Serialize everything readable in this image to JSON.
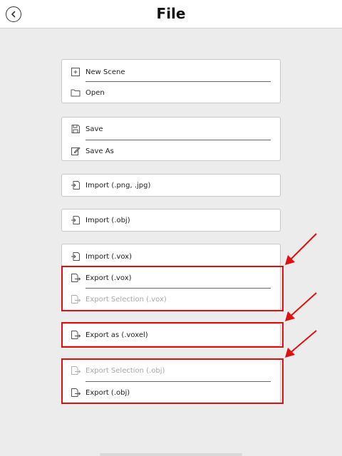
{
  "header": {
    "title": "File"
  },
  "groups": {
    "scene": {
      "new_scene": "New Scene",
      "open": "Open"
    },
    "save": {
      "save": "Save",
      "save_as": "Save As"
    },
    "import_png": {
      "label": "Import (.png, .jpg)"
    },
    "import_obj": {
      "label": "Import (.obj)"
    },
    "vox": {
      "import_vox": "Import (.vox)",
      "export_vox": "Export (.vox)",
      "export_selection_vox": "Export Selection (.vox)"
    },
    "voxel": {
      "export_voxel": "Export as (.voxel)"
    },
    "obj": {
      "export_selection_obj": "Export Selection (.obj)",
      "export_obj": "Export (.obj)"
    }
  },
  "annotations": {
    "highlight_color": "#e01010"
  }
}
